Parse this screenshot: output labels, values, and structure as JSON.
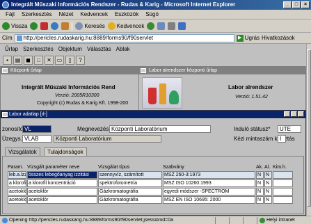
{
  "window": {
    "title": "Integrált Műszaki Információs Rendszer - Rudas & Karig - Microsoft Internet Explorer"
  },
  "ie_menu": [
    "Fájl",
    "Szerkesztés",
    "Nézet",
    "Kedvencek",
    "Eszközök",
    "Súgó"
  ],
  "ie_toolbar": {
    "back": "Vissza",
    "search": "Keresés",
    "favorites": "Kedvencek"
  },
  "address": {
    "label": "Cím",
    "url": "http://pericles.rudaskarig.hu:8889/forms90/f90servlet",
    "go": "Ugrás",
    "links": "Hivatkozások"
  },
  "app_menu": [
    "Űrlap",
    "Szerkesztés",
    "Objektum",
    "Választás",
    "Ablak"
  ],
  "win_kozponti": {
    "title": "Központi űrlap",
    "heading": "Integrált Műszaki Információs Rend",
    "version": "Verzió: 2005R10300",
    "copyright": "Copyright (c) Rudas & Karig Kft. 1998-200"
  },
  "win_labor": {
    "title": "Labor alrendszer központi űrlap",
    "heading": "Labor alrendszer",
    "version": "Verzió: 1.51.42"
  },
  "labor_adatlap": {
    "title": "Labor adatlap  [d-]",
    "azonosito_label": "zonosító",
    "azonosito_value": "VL",
    "megnevezes_label": "Megnevezés",
    "megnevezes_value": "Központi Laboratórium",
    "indulo_label": "Induló státusz*",
    "indulo_value": "UTE",
    "uzegys_label": "Üzegys.*",
    "uzegys_value": "VLAB",
    "uzegys_name": "Központi Laboratórium",
    "kezi_label": "Kézi mintaszám kiosztás",
    "kezi_value": "I",
    "tabs": [
      "Vizsgálatok",
      "Tulajdonságok"
    ],
    "columns": [
      "Param.",
      "Vizsgált paraméter neve",
      "Vizsgálat típus",
      "Szabvány",
      "Ak.",
      "Al.",
      "Kim.h."
    ],
    "rows": [
      [
        "leb.a.lzz",
        "összes lebegőanyag izzitási",
        "szennyvíz, számított",
        "MSZ 260-3:1973",
        "N",
        "N",
        ""
      ],
      [
        "a klorofil",
        "a klorofil koncentráció",
        "spektrofotometria",
        "MSZ ISO 10260:1993",
        "N",
        "N",
        ""
      ],
      [
        "acetoklór",
        "acetoklór",
        "Gázkromatográfia",
        "egyedi módszer -SPECTROM",
        "N",
        "N",
        ""
      ],
      [
        "acetoklór",
        "acetoklór",
        "Gázkromatográfia",
        "MSZ EN ISO 10695: 2000",
        "N",
        "N",
        ""
      ]
    ]
  },
  "status": {
    "text": "Opening http://pericles.rudaskarig.hu:8889/forms90/f90servlet;jsessionid=0a",
    "zone": "Helyi intranet"
  }
}
